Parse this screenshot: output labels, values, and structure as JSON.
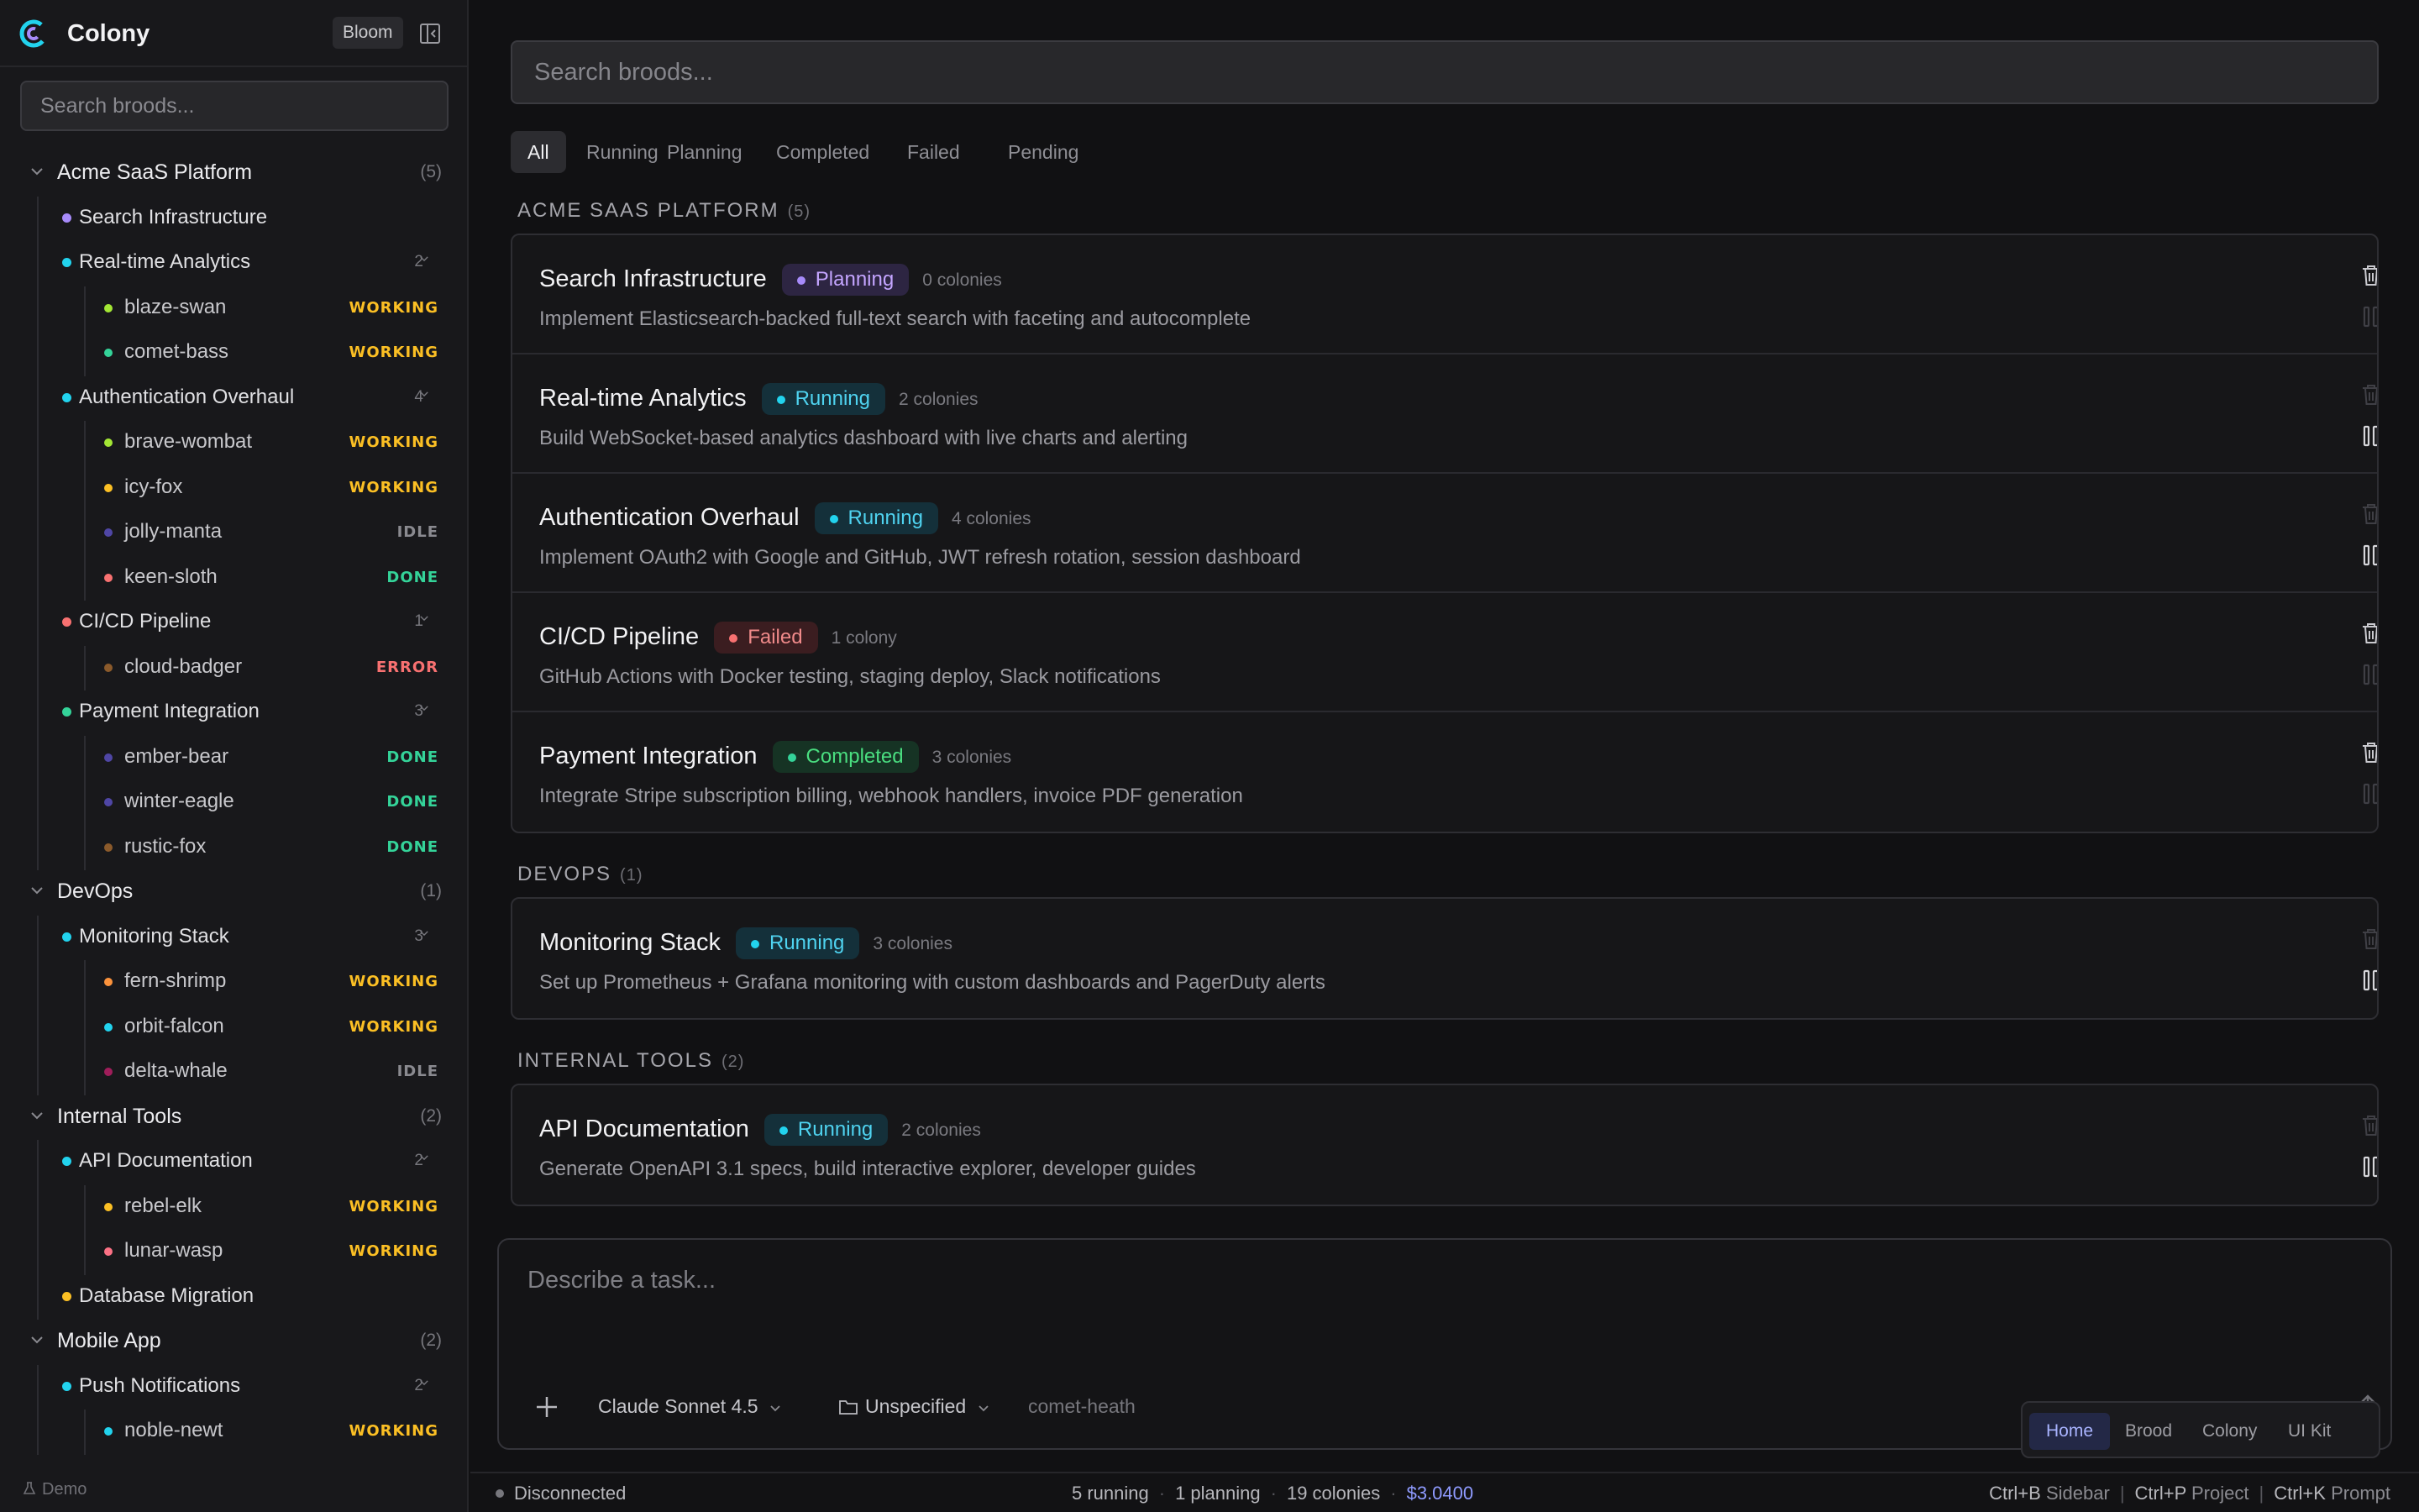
{
  "app": {
    "title": "Colony",
    "badge": "Bloom"
  },
  "sidebar": {
    "search_placeholder": "Search broods...",
    "footer": "Demo",
    "projects": [
      {
        "name": "Acme SaaS Platform",
        "count": "(5)",
        "broods": [
          {
            "name": "Search Infrastructure",
            "dot": "#a78bfa",
            "count": "",
            "colonies": []
          },
          {
            "name": "Real-time Analytics",
            "dot": "#22d3ee",
            "count": "2",
            "colonies": [
              {
                "name": "blaze-swan",
                "dot": "#a3e635",
                "status": "WORKING",
                "color": "#fbbf24"
              },
              {
                "name": "comet-bass",
                "dot": "#34d399",
                "status": "WORKING",
                "color": "#fbbf24"
              }
            ]
          },
          {
            "name": "Authentication Overhaul",
            "dot": "#22d3ee",
            "count": "4",
            "colonies": [
              {
                "name": "brave-wombat",
                "dot": "#a3e635",
                "status": "WORKING",
                "color": "#fbbf24"
              },
              {
                "name": "icy-fox",
                "dot": "#fbbf24",
                "status": "WORKING",
                "color": "#fbbf24"
              },
              {
                "name": "jolly-manta",
                "dot": "#4f46a5",
                "status": "IDLE",
                "color": "#8a8a90"
              },
              {
                "name": "keen-sloth",
                "dot": "#f87171",
                "status": "DONE",
                "color": "#34d399"
              }
            ]
          },
          {
            "name": "CI/CD Pipeline",
            "dot": "#f87171",
            "count": "1",
            "colonies": [
              {
                "name": "cloud-badger",
                "dot": "#8b5a2b",
                "status": "ERROR",
                "color": "#f87171"
              }
            ]
          },
          {
            "name": "Payment Integration",
            "dot": "#34d399",
            "count": "3",
            "colonies": [
              {
                "name": "ember-bear",
                "dot": "#4f46a5",
                "status": "DONE",
                "color": "#34d399"
              },
              {
                "name": "winter-eagle",
                "dot": "#4f46a5",
                "status": "DONE",
                "color": "#34d399"
              },
              {
                "name": "rustic-fox",
                "dot": "#8b5a2b",
                "status": "DONE",
                "color": "#34d399"
              }
            ]
          }
        ]
      },
      {
        "name": "DevOps",
        "count": "(1)",
        "broods": [
          {
            "name": "Monitoring Stack",
            "dot": "#22d3ee",
            "count": "3",
            "colonies": [
              {
                "name": "fern-shrimp",
                "dot": "#fb923c",
                "status": "WORKING",
                "color": "#fbbf24"
              },
              {
                "name": "orbit-falcon",
                "dot": "#22d3ee",
                "status": "WORKING",
                "color": "#fbbf24"
              },
              {
                "name": "delta-whale",
                "dot": "#9f1d5a",
                "status": "IDLE",
                "color": "#8a8a90"
              }
            ]
          }
        ]
      },
      {
        "name": "Internal Tools",
        "count": "(2)",
        "broods": [
          {
            "name": "API Documentation",
            "dot": "#22d3ee",
            "count": "2",
            "colonies": [
              {
                "name": "rebel-elk",
                "dot": "#fbbf24",
                "status": "WORKING",
                "color": "#fbbf24"
              },
              {
                "name": "lunar-wasp",
                "dot": "#fb7185",
                "status": "WORKING",
                "color": "#fbbf24"
              }
            ]
          },
          {
            "name": "Database Migration",
            "dot": "#fbbf24",
            "count": "",
            "colonies": []
          }
        ]
      },
      {
        "name": "Mobile App",
        "count": "(2)",
        "broods": [
          {
            "name": "Push Notifications",
            "dot": "#22d3ee",
            "count": "2",
            "colonies": [
              {
                "name": "noble-newt",
                "dot": "#22d3ee",
                "status": "WORKING",
                "color": "#fbbf24"
              }
            ]
          }
        ]
      }
    ]
  },
  "main": {
    "search_placeholder": "Search broods...",
    "tabs": [
      "All",
      "Running",
      "Planning",
      "Completed",
      "Failed",
      "Pending"
    ],
    "active_tab": "All",
    "status_colors": {
      "Planning": {
        "fg": "#c4a5ff",
        "bg": "#2d2542",
        "dot": "#a78bfa"
      },
      "Running": {
        "fg": "#4fd3f0",
        "bg": "#14303a",
        "dot": "#22d3ee"
      },
      "Failed": {
        "fg": "#f08a8a",
        "bg": "#3b1d20",
        "dot": "#f87171"
      },
      "Completed": {
        "fg": "#4ade80",
        "bg": "#163324",
        "dot": "#34d399"
      }
    },
    "sections": [
      {
        "title": "ACME SAAS PLATFORM",
        "count": "(5)",
        "cards": [
          {
            "title": "Search Infrastructure",
            "status": "Planning",
            "colonies": "0 colonies",
            "desc": "Implement Elasticsearch-backed full-text search with faceting and autocomplete",
            "trash_active": true,
            "pause_active": false
          },
          {
            "title": "Real-time Analytics",
            "status": "Running",
            "colonies": "2 colonies",
            "desc": "Build WebSocket-based analytics dashboard with live charts and alerting",
            "trash_active": false,
            "pause_active": true
          },
          {
            "title": "Authentication Overhaul",
            "status": "Running",
            "colonies": "4 colonies",
            "desc": "Implement OAuth2 with Google and GitHub, JWT refresh rotation, session dashboard",
            "trash_active": false,
            "pause_active": true
          },
          {
            "title": "CI/CD Pipeline",
            "status": "Failed",
            "colonies": "1 colony",
            "desc": "GitHub Actions with Docker testing, staging deploy, Slack notifications",
            "trash_active": true,
            "pause_active": false
          },
          {
            "title": "Payment Integration",
            "status": "Completed",
            "colonies": "3 colonies",
            "desc": "Integrate Stripe subscription billing, webhook handlers, invoice PDF generation",
            "trash_active": true,
            "pause_active": false
          }
        ]
      },
      {
        "title": "DEVOPS",
        "count": "(1)",
        "cards": [
          {
            "title": "Monitoring Stack",
            "status": "Running",
            "colonies": "3 colonies",
            "desc": "Set up Prometheus + Grafana monitoring with custom dashboards and PagerDuty alerts",
            "trash_active": false,
            "pause_active": true
          }
        ]
      },
      {
        "title": "INTERNAL TOOLS",
        "count": "(2)",
        "cards": [
          {
            "title": "API Documentation",
            "status": "Running",
            "colonies": "2 colonies",
            "desc": "Generate OpenAPI 3.1 specs, build interactive explorer, developer guides",
            "trash_active": false,
            "pause_active": true
          }
        ]
      }
    ]
  },
  "composer": {
    "placeholder": "Describe a task...",
    "model": "Claude Sonnet 4.5",
    "directory": "Unspecified",
    "branch": "comet-heath"
  },
  "nav": {
    "items": [
      "Home",
      "Brood",
      "Colony",
      "UI Kit"
    ],
    "active": "Home"
  },
  "statusbar": {
    "connection": "Disconnected",
    "running": "5 running",
    "planning": "1 planning",
    "colonies": "19 colonies",
    "cost": "$3.0400",
    "shortcuts": [
      {
        "key": "Ctrl+B",
        "label": "Sidebar"
      },
      {
        "key": "Ctrl+P",
        "label": "Project"
      },
      {
        "key": "Ctrl+K",
        "label": "Prompt"
      }
    ]
  }
}
